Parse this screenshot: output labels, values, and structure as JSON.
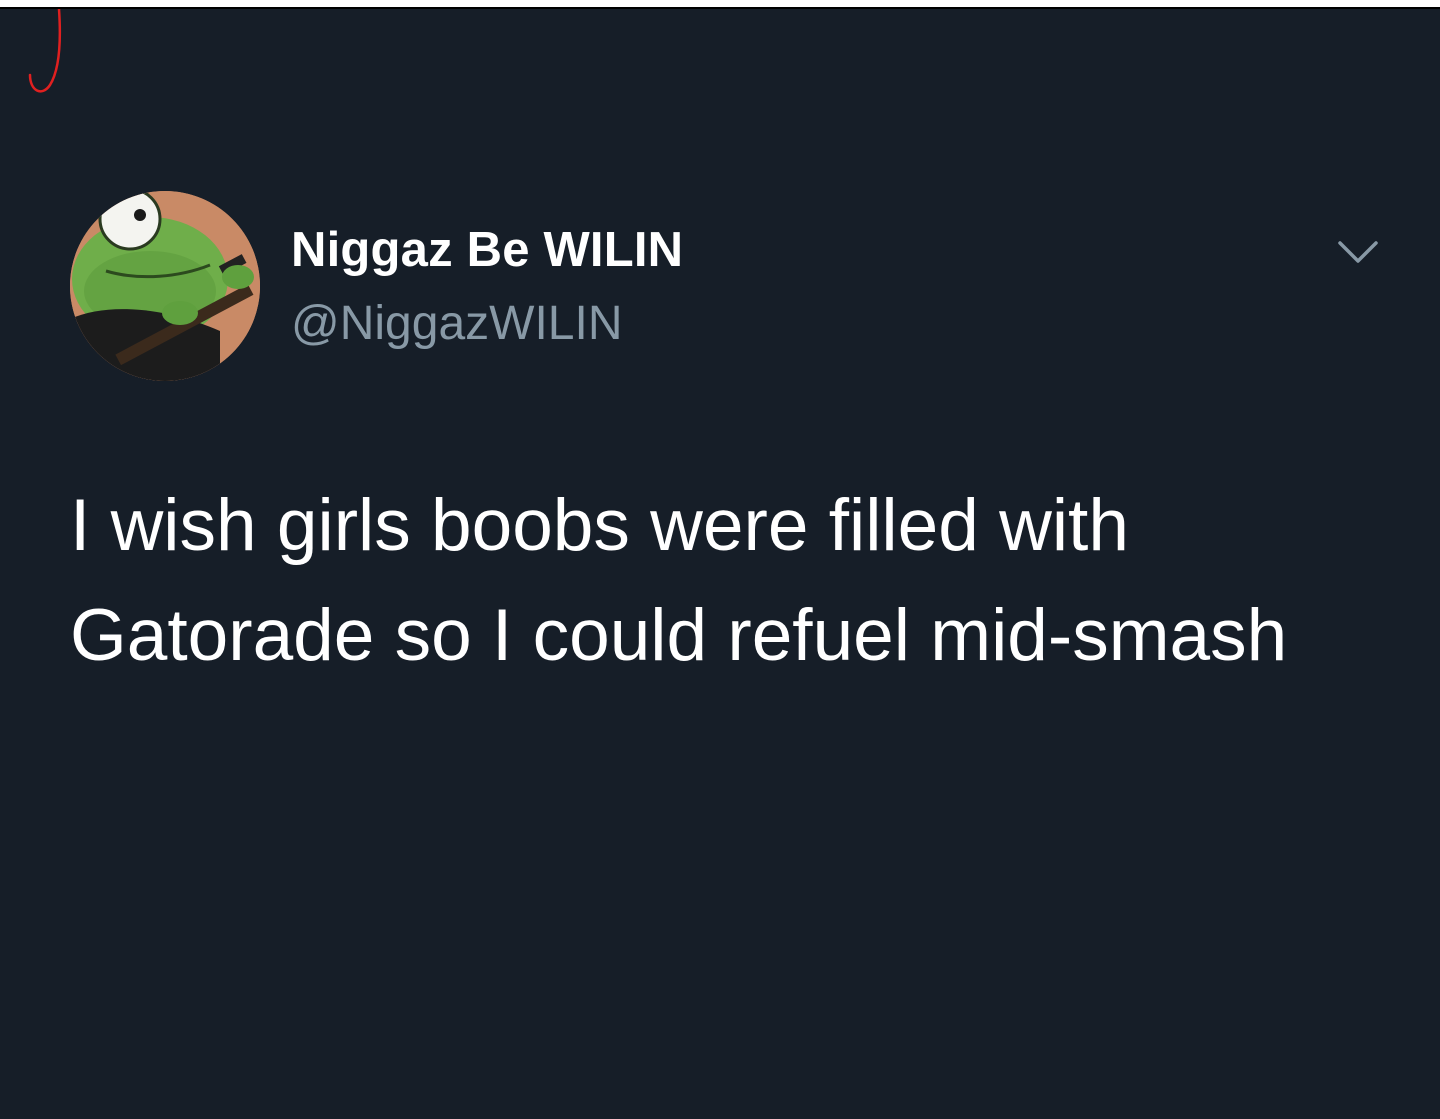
{
  "tweet": {
    "author": {
      "display_name": "Niggaz Be WILIN",
      "handle": "@NiggazWILIN",
      "avatar_icon": "frog-cartoon-avatar"
    },
    "text_lines": [
      "I wish girls boobs were filled with",
      "Gatorade so I could refuel mid-smash"
    ],
    "menu_icon": "chevron-down-icon"
  },
  "colors": {
    "background": "#161e28",
    "primary_text": "#ffffff",
    "secondary_text": "#8899a6",
    "annotation_mark": "#e02020"
  }
}
